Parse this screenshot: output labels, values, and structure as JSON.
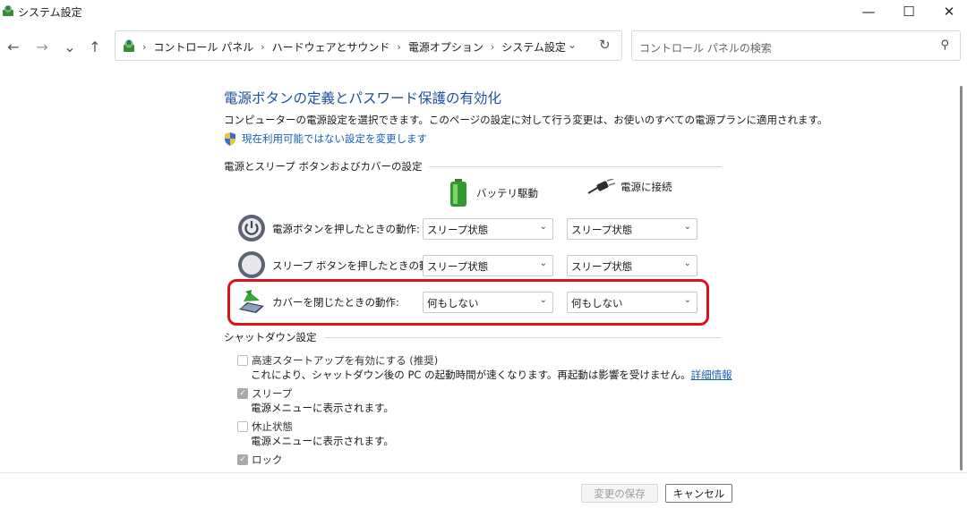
{
  "window": {
    "title": "システム設定",
    "icon": "control-panel-icon",
    "controls": {
      "minimize": "—",
      "maximize": "☐",
      "close": "✕"
    }
  },
  "nav": {
    "back": "←",
    "forward": "→",
    "recent": "⌄",
    "up": "↑"
  },
  "breadcrumb": {
    "items": [
      "コントロール パネル",
      "ハードウェアとサウンド",
      "電源オプション",
      "システム設定"
    ],
    "separator": "›"
  },
  "search": {
    "placeholder": "コントロール パネルの検索"
  },
  "page": {
    "title": "電源ボタンの定義とパスワード保護の有効化",
    "description": "コンピューターの電源設定を選択できます。このページの設定に対して行う変更は、お使いのすべての電源プランに適用されます。",
    "change_link": "現在利用可能ではない設定を変更します"
  },
  "power_section": {
    "title": "電源とスリープ ボタンおよびカバーの設定",
    "col_battery": "バッテリ駆動",
    "col_plugged": "電源に接続",
    "rows": [
      {
        "label": "電源ボタンを押したときの動作:",
        "battery": "スリープ状態",
        "plugged": "スリープ状態",
        "icon": "power-button-icon"
      },
      {
        "label": "スリープ ボタンを押したときの動作:",
        "battery": "スリープ状態",
        "plugged": "スリープ状態",
        "icon": "sleep-button-icon"
      },
      {
        "label": "カバーを閉じたときの動作:",
        "battery": "何もしない",
        "plugged": "何もしない",
        "icon": "laptop-lid-icon"
      }
    ]
  },
  "shutdown_section": {
    "title": "シャットダウン設定",
    "items": [
      {
        "label": "高速スタートアップを有効にする (推奨)",
        "checked": false,
        "desc": "これにより、シャットダウン後の PC の起動時間が速くなります。再起動は影響を受けません。",
        "link": "詳細情報"
      },
      {
        "label": "スリープ",
        "checked": true,
        "desc": "電源メニューに表示されます。"
      },
      {
        "label": "休止状態",
        "checked": false,
        "desc": "電源メニューに表示されます。"
      },
      {
        "label": "ロック",
        "checked": true
      }
    ]
  },
  "footer": {
    "save": "変更の保存",
    "cancel": "キャンセル"
  },
  "colors": {
    "accent": "#1f4fa0",
    "link": "#1a5fb4",
    "highlight": "#e0101a"
  }
}
